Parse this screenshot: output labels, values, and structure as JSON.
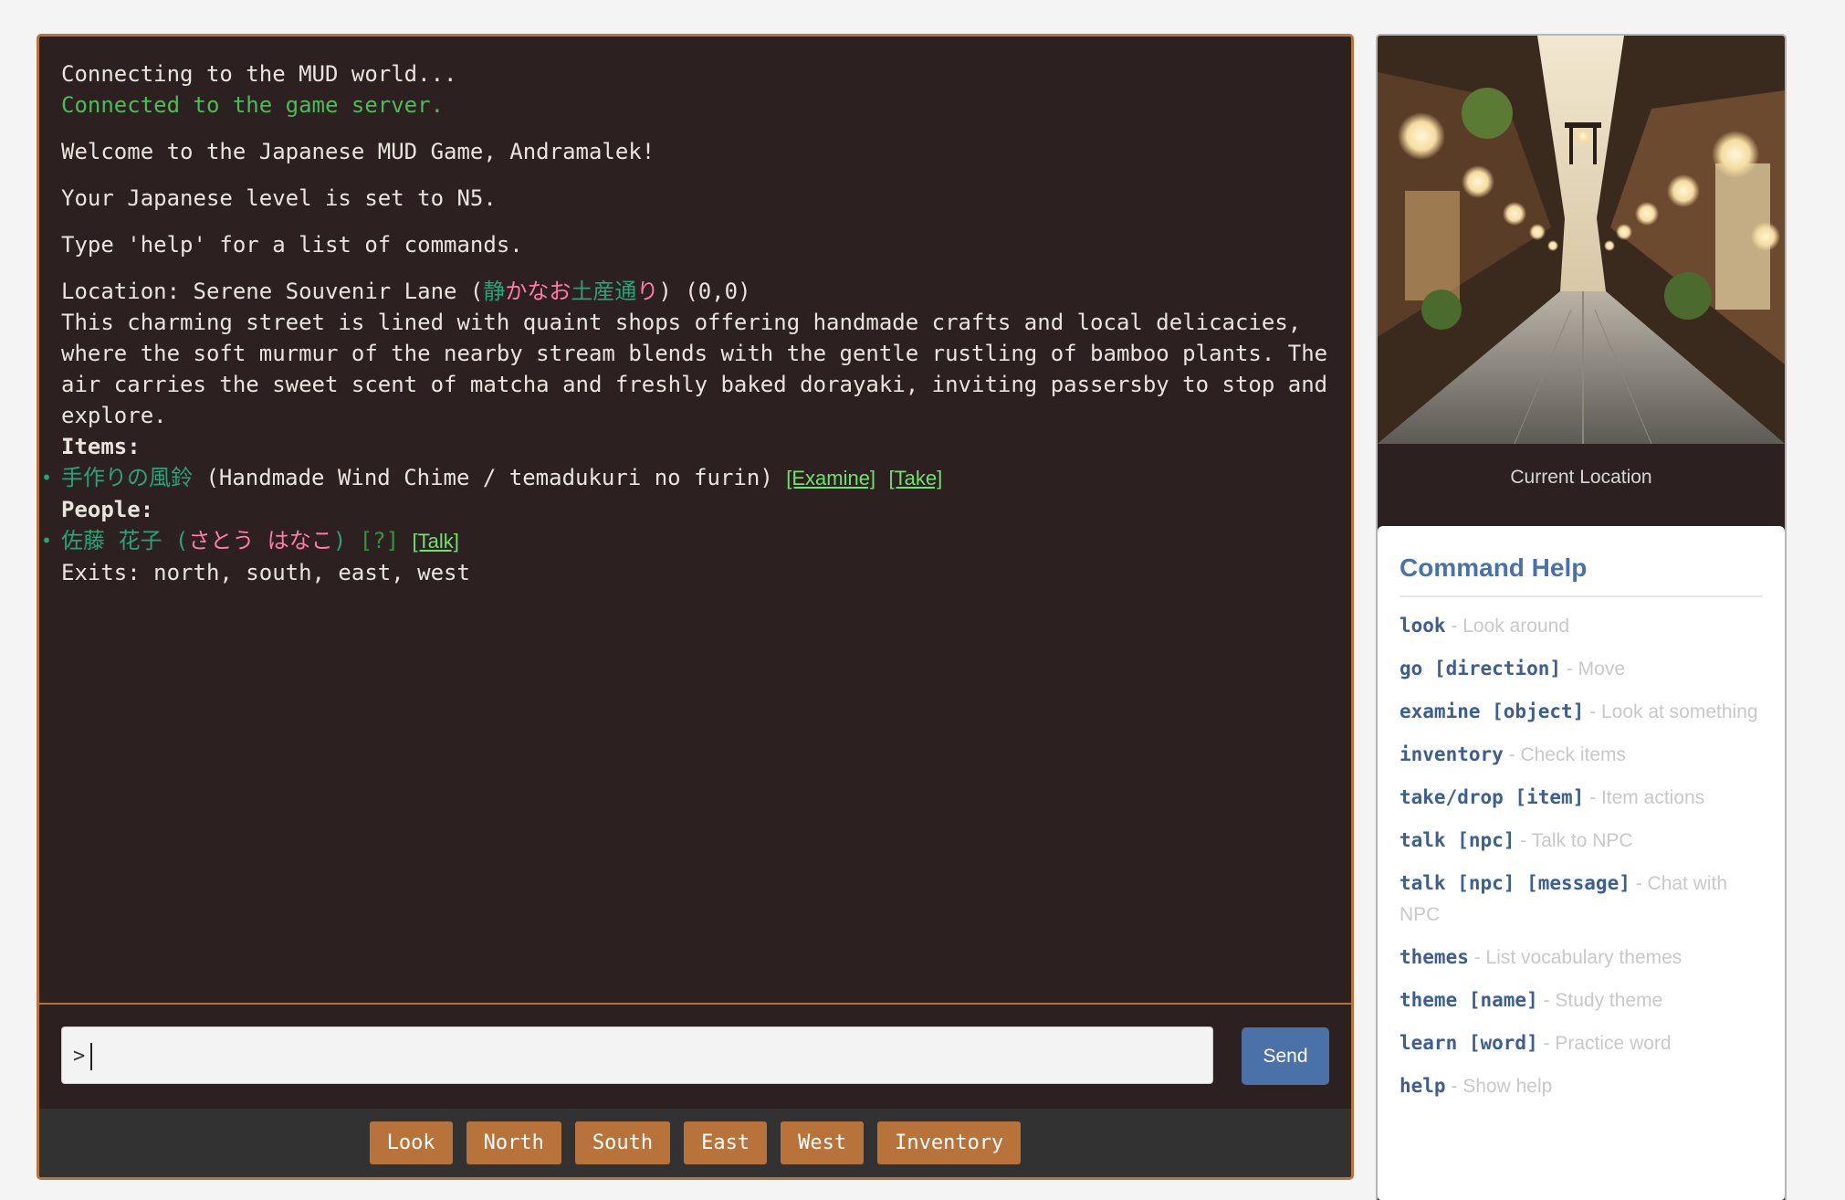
{
  "terminal": {
    "connecting": "Connecting to the MUD world...",
    "connected": "Connected to the game server.",
    "welcome": "Welcome to the Japanese MUD Game, Andramalek!",
    "level": "Your Japanese level is set to N5.",
    "help_hint": "Type 'help' for a list of commands.",
    "location": {
      "prefix": "Location: Serene Souvenir Lane (",
      "seg1": "静",
      "seg2": "かなお",
      "seg3": "土産通",
      "seg4": "り",
      "suffix": ") (0,0)"
    },
    "description_lines": [
      "This charming street is lined with quaint shops offering handmade crafts and local delicacies,",
      "where the soft murmur of the nearby stream blends with the gentle rustling of bamboo plants. The",
      "air carries the sweet scent of matcha and freshly baked dorayaki, inviting passersby to stop and",
      "explore."
    ],
    "items_header": "Items:",
    "item": {
      "name_jp": "手作りの風鈴",
      "desc": " (Handmade Wind Chime / temadukuri no furin) ",
      "examine": "[Examine]",
      "take": "[Take]"
    },
    "people_header": "People:",
    "person": {
      "name_kanji": "佐藤 花子",
      "open_paren": " (",
      "name_kana": "さとう はなこ",
      "close_paren": ")",
      "hint": " [?] ",
      "talk": "[Talk]"
    },
    "exits": "Exits: north, south, east, west"
  },
  "input": {
    "prompt": ">",
    "value": ""
  },
  "send_label": "Send",
  "quick_buttons": [
    "Look",
    "North",
    "South",
    "East",
    "West",
    "Inventory"
  ],
  "location_caption": "Current Location",
  "help": {
    "title": "Command Help",
    "items": [
      {
        "cmd": "look",
        "desc": " - Look around"
      },
      {
        "cmd": "go [direction]",
        "desc": " - Move"
      },
      {
        "cmd": "examine [object]",
        "desc": " - Look at something"
      },
      {
        "cmd": "inventory",
        "desc": " - Check items"
      },
      {
        "cmd": "take/drop [item]",
        "desc": " - Item actions"
      },
      {
        "cmd": "talk [npc]",
        "desc": " - Talk to NPC"
      },
      {
        "cmd": "talk [npc] [message]",
        "desc": " - Chat with NPC"
      },
      {
        "cmd": "themes",
        "desc": " - List vocabulary themes"
      },
      {
        "cmd": "theme [name]",
        "desc": " - Study theme"
      },
      {
        "cmd": "learn [word]",
        "desc": " - Practice word"
      },
      {
        "cmd": "help",
        "desc": " - Show help"
      }
    ]
  },
  "colors": {
    "terminal_bg": "#2c2020",
    "accent_orange": "#b8733a",
    "send_blue": "#4a72a8",
    "connected_green": "#4cbc56",
    "link_green": "#6fe26f",
    "jp_teal": "#2aa27a",
    "jp_pink": "#ff7ca8"
  }
}
